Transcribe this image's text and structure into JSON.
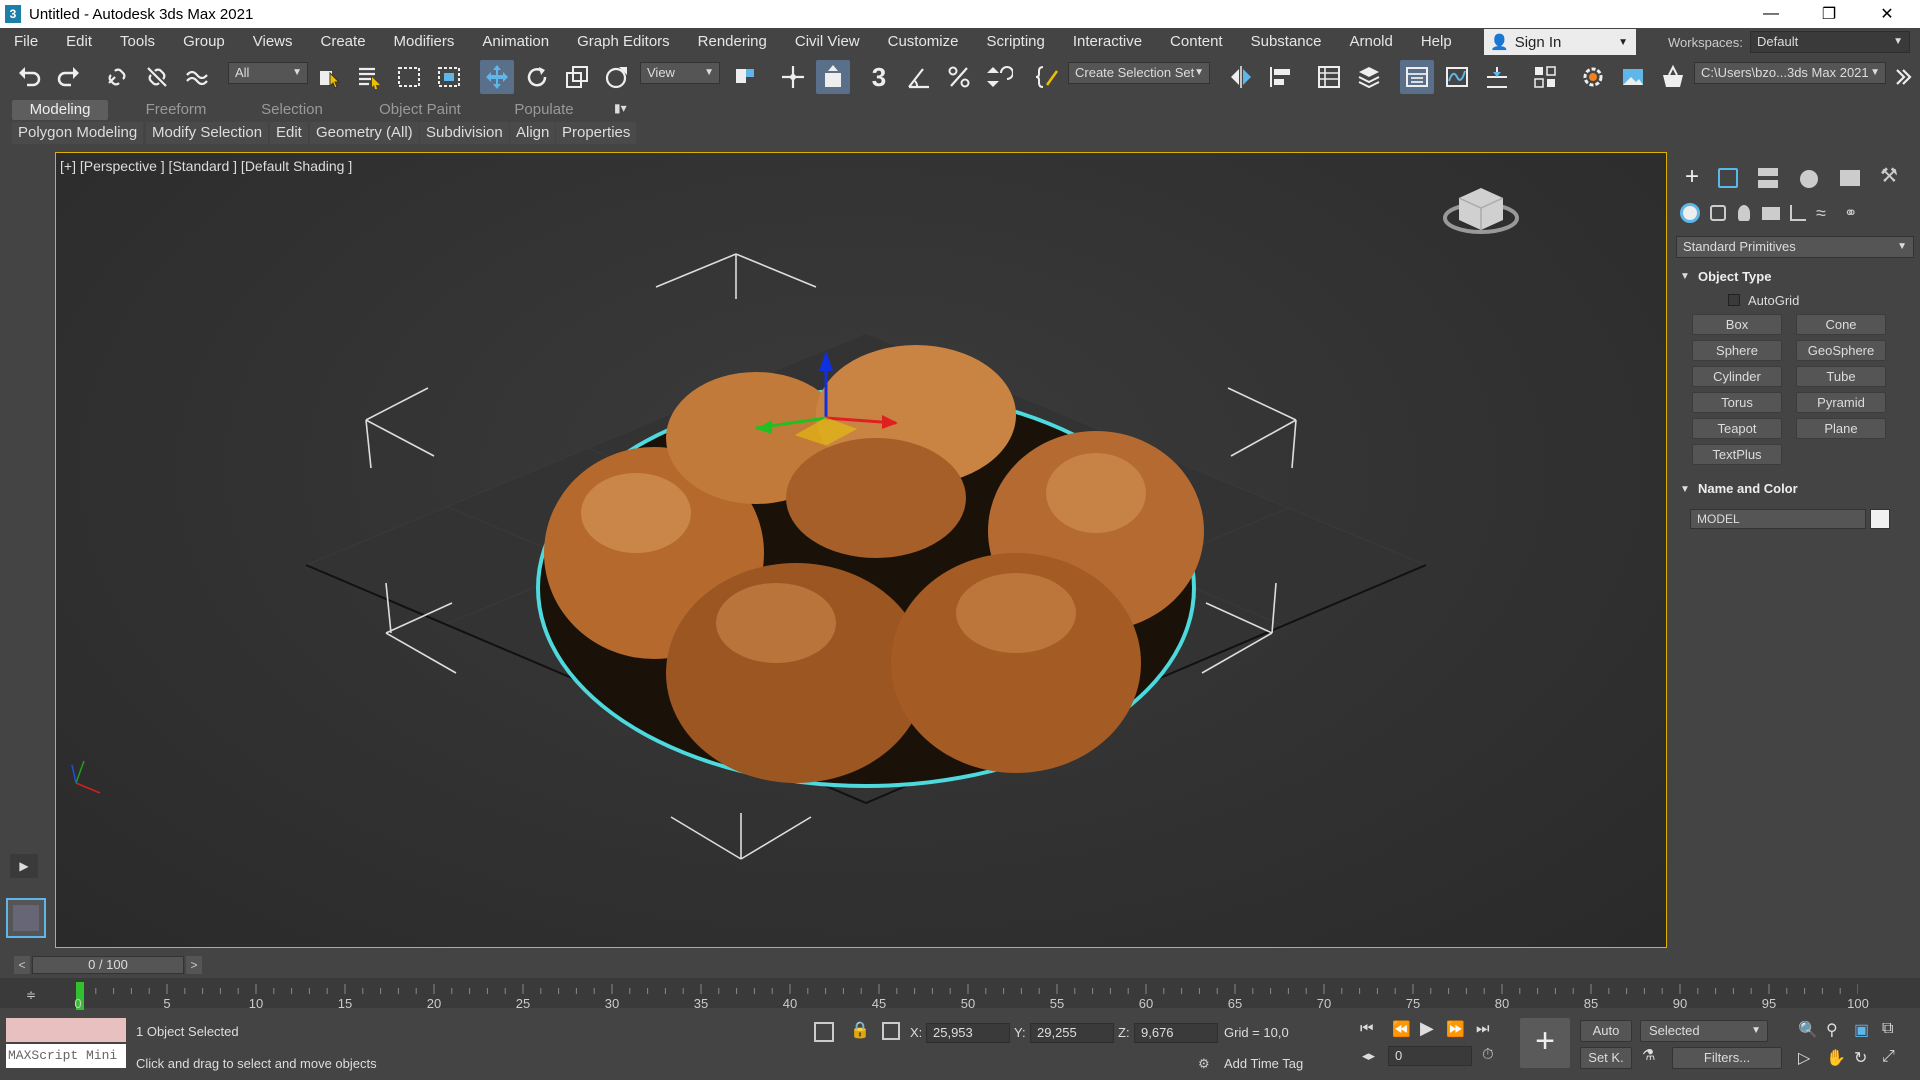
{
  "window": {
    "title": "Untitled - Autodesk 3ds Max 2021",
    "app_icon_glyph": "3",
    "controls": [
      "minimize-icon",
      "restore-icon",
      "close-icon"
    ]
  },
  "menu": {
    "items": [
      "File",
      "Edit",
      "Tools",
      "Group",
      "Views",
      "Create",
      "Modifiers",
      "Animation",
      "Graph Editors",
      "Rendering",
      "Civil View",
      "Customize",
      "Scripting",
      "Interactive",
      "Content",
      "Substance",
      "Arnold",
      "Help"
    ],
    "sign_in": "Sign In",
    "workspaces_label": "Workspaces:",
    "workspace_value": "Default"
  },
  "toolbar": {
    "selection_filter": "All",
    "ref_coord": "View",
    "selection_set_placeholder": "Create Selection Set",
    "project_path": "C:\\Users\\bzo...3ds Max 2021",
    "snap_label": "3"
  },
  "ribbon": {
    "tabs": [
      "Modeling",
      "Freeform",
      "Selection",
      "Object Paint",
      "Populate"
    ],
    "active_tab": "Modeling",
    "subtabs": [
      "Polygon Modeling",
      "Modify Selection",
      "Edit",
      "Geometry (All)",
      "Subdivision",
      "Align",
      "Properties"
    ]
  },
  "viewport": {
    "label": "[+] [Perspective ] [Standard ] [Default Shading ]",
    "selection_outline_color": "#4fe3e8",
    "border_color": "#e0b000"
  },
  "command_panel": {
    "category": "Standard Primitives",
    "object_type_header": "Object Type",
    "autogrid": "AutoGrid",
    "buttons": [
      "Box",
      "Cone",
      "Sphere",
      "GeoSphere",
      "Cylinder",
      "Tube",
      "Torus",
      "Pyramid",
      "Teapot",
      "Plane",
      "TextPlus"
    ],
    "name_color_header": "Name and Color",
    "object_name": "MODEL"
  },
  "timeline": {
    "frame_display": "0 / 100",
    "prev": "<",
    "next": ">",
    "ticks": [
      "0",
      "5",
      "10",
      "15",
      "20",
      "25",
      "30",
      "35",
      "40",
      "45",
      "50",
      "55",
      "60",
      "65",
      "70",
      "75",
      "80",
      "85",
      "90",
      "95",
      "100"
    ]
  },
  "status": {
    "maxscript": "MAXScript Mini",
    "selected": "1 Object Selected",
    "hint": "Click and drag to select and move objects",
    "x_label": "X:",
    "x": "25,953",
    "y_label": "Y:",
    "y": "29,255",
    "z_label": "Z:",
    "z": "9,676",
    "grid": "Grid = 10,0",
    "add_time_tag": "Add Time Tag",
    "auto": "Auto",
    "set_key": "Set K.",
    "key_mode": "Selected",
    "filters": "Filters...",
    "current_frame": "0"
  }
}
